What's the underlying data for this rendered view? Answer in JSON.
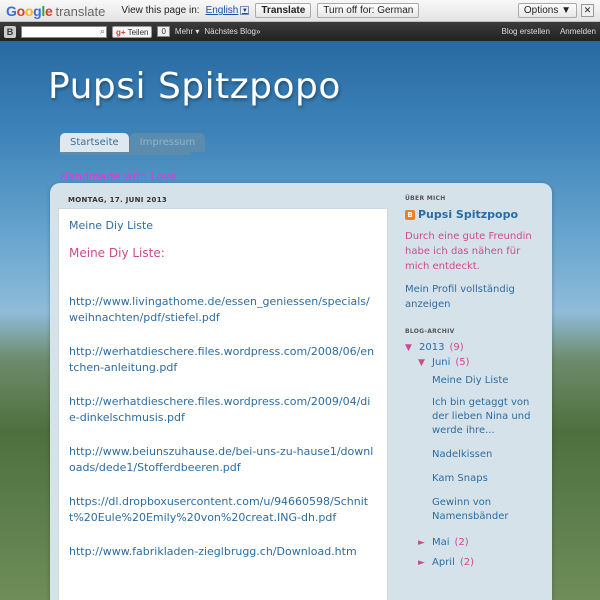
{
  "translate_bar": {
    "google": "Google",
    "translate": "translate",
    "prompt": "View this page in:",
    "language": "English",
    "translate_button": "Translate",
    "turn_off_button": "Turn off for: German",
    "options_button": "Options ▼",
    "close": "✕"
  },
  "navbar": {
    "gplus": "Teilen",
    "zero": "0",
    "more": "Mehr ▾",
    "next_blog": "Nächstes Blog»",
    "create_blog": "Blog erstellen",
    "login": "Anmelden"
  },
  "header": {
    "title": "Pupsi Spitzpopo",
    "tabs": [
      "Startseite",
      "Impressum"
    ],
    "tagline": "Handmade with Love"
  },
  "post": {
    "date": "MONTAG, 17. JUNI 2013",
    "title": "Meine Diy Liste",
    "subtitle": "Meine Diy Liste:",
    "links": [
      "http://www.livingathome.de/essen_geniessen/specials/weihnachten/pdf/stiefel.pdf",
      "http://werhatdieschere.files.wordpress.com/2008/06/entchen-anleitung.pdf",
      "http://werhatdieschere.files.wordpress.com/2009/04/die-dinkelschmusis.pdf",
      "http://www.beiunszuhause.de/bei-uns-zu-hause1/downloads/dede1/Stofferdbeeren.pdf",
      "https://dl.dropboxusercontent.com/u/94660598/Schnitt%20Eule%20Emily%20von%20creat.ING-dh.pdf",
      "http://www.fabrikladen-zieglbrugg.ch/Download.htm"
    ]
  },
  "sidebar": {
    "about_head": "ÜBER MICH",
    "profile_name": "Pupsi Spitzpopo",
    "about_text": "Durch eine gute Freundin habe ich das nähen für mich entdeckt.",
    "profile_link": "Mein Profil vollständig anzeigen",
    "archive_head": "BLOG-ARCHIV",
    "year": {
      "toggle": "▼",
      "label": "2013",
      "count": "(9)"
    },
    "month_open": {
      "toggle": "▼",
      "label": "Juni",
      "count": "(5)"
    },
    "posts": [
      "Meine Diy Liste",
      "Ich bin getaggt von der lieben Nina und werde ihre...",
      "Nadelkissen",
      "Kam Snaps",
      "Gewinn von Namensbänder"
    ],
    "months": [
      {
        "toggle": "►",
        "label": "Mai",
        "count": "(2)"
      },
      {
        "toggle": "►",
        "label": "April",
        "count": "(2)"
      }
    ]
  }
}
